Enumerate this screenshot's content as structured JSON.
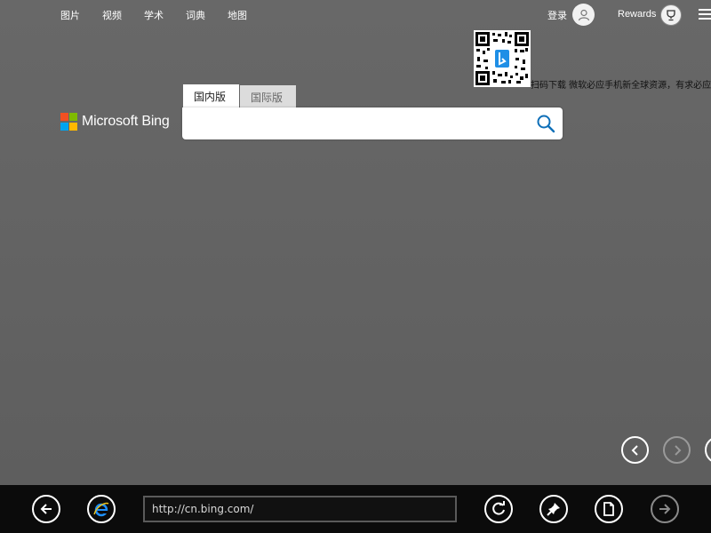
{
  "nav": {
    "items": [
      "图片",
      "视频",
      "学术",
      "词典",
      "地图"
    ],
    "login_label": "登录",
    "rewards_label": "Rewards"
  },
  "qr": {
    "caption": "扫码下载 微软必应手机新全球资源，有求必应"
  },
  "logo": {
    "text": "Microsoft Bing",
    "colors": [
      "#f25022",
      "#7fba00",
      "#00a4ef",
      "#ffb900"
    ]
  },
  "search": {
    "tabs": [
      {
        "label": "国内版",
        "selected": true
      },
      {
        "label": "国际版",
        "selected": false
      }
    ],
    "value": "",
    "placeholder": ""
  },
  "carousel": {
    "prev_icon": "chevron-left-icon",
    "next_icon": "chevron-right-icon"
  },
  "appbar": {
    "address": "http://cn.bing.com/",
    "buttons": [
      "back-icon",
      "ie-icon",
      "refresh-icon",
      "pin-icon",
      "page-tools-icon",
      "forward-icon"
    ]
  },
  "colors": {
    "background": "#646464",
    "appbar": "#0b0b0b",
    "accent": "#0078d4"
  }
}
